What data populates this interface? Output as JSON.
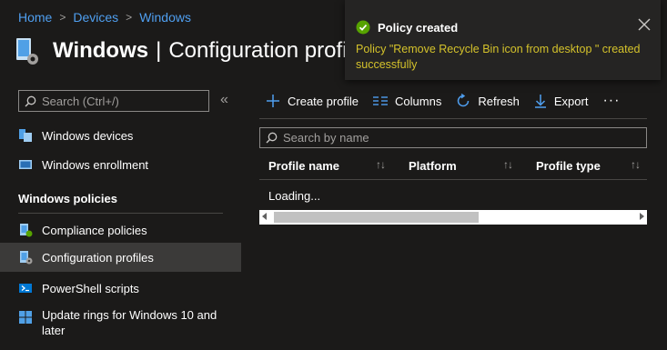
{
  "breadcrumb": {
    "items": [
      "Home",
      "Devices",
      "Windows"
    ]
  },
  "header": {
    "title_strong": "Windows",
    "title_divider": "|",
    "title_rest": "Configuration profi"
  },
  "sidebar": {
    "search_placeholder": "Search (Ctrl+/)",
    "collapse_glyph": "«",
    "items_top": [
      {
        "label": "Windows devices",
        "icon": "windows-devices-icon"
      },
      {
        "label": "Windows enrollment",
        "icon": "windows-enrollment-icon"
      }
    ],
    "section_header": "Windows policies",
    "items_policies": [
      {
        "label": "Compliance policies",
        "icon": "compliance-policies-icon"
      },
      {
        "label": "Configuration profiles",
        "icon": "configuration-profiles-icon",
        "active": true
      },
      {
        "label": "PowerShell scripts",
        "icon": "powershell-scripts-icon"
      },
      {
        "label": "Update rings for Windows 10 and later",
        "icon": "windows-logo-icon"
      }
    ]
  },
  "toolbar": {
    "create_label": "Create profile",
    "columns_label": "Columns",
    "refresh_label": "Refresh",
    "export_label": "Export",
    "more_glyph": "···"
  },
  "main": {
    "search_placeholder": "Search by name",
    "columns": [
      "Profile name",
      "Platform",
      "Profile type"
    ],
    "sort_glyph": "↑↓",
    "loading_text": "Loading..."
  },
  "toast": {
    "title": "Policy created",
    "message": "Policy \"Remove Recycle Bin icon from desktop \" created successfully"
  },
  "colors": {
    "background": "#1b1a19",
    "link": "#4f9ff0",
    "toast_message": "#d4c22b",
    "success": "#57a300"
  }
}
